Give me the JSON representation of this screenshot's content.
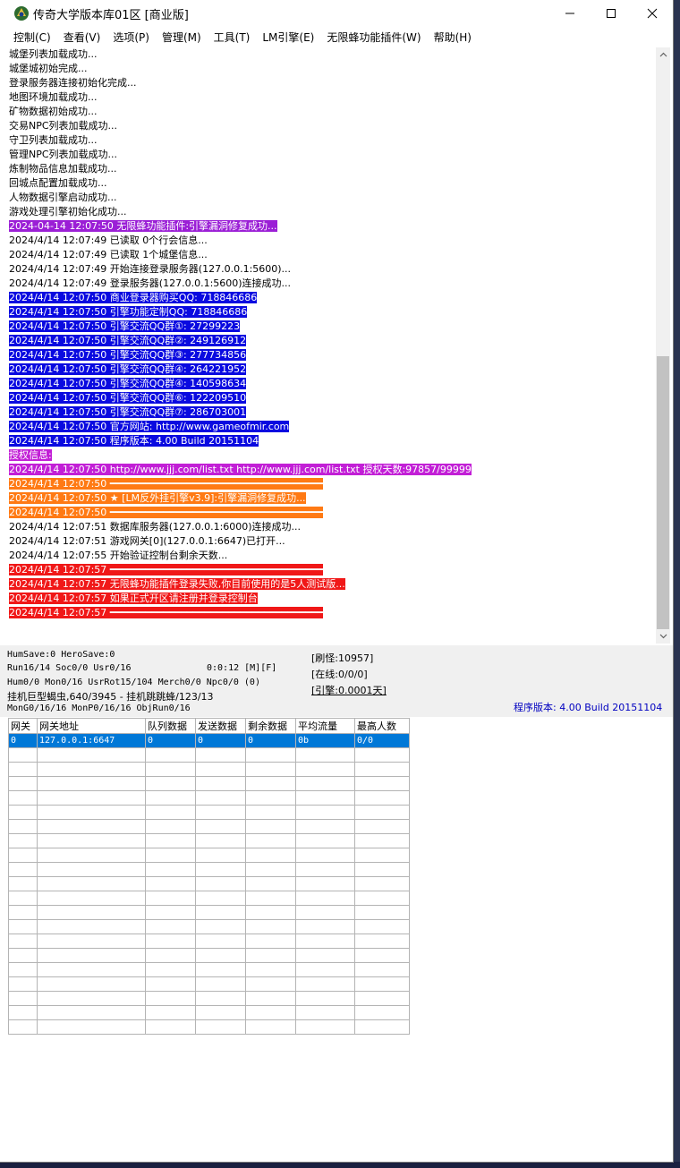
{
  "window": {
    "title": "传奇大学版本库01区 [商业版]",
    "minimize": "—",
    "maximize": "☐",
    "close": "✕"
  },
  "menu": [
    "控制(C)",
    "查看(V)",
    "选项(P)",
    "管理(M)",
    "工具(T)",
    "LM引擎(E)",
    "无限蜂功能插件(W)",
    "帮助(H)"
  ],
  "log": [
    {
      "text": "城堡列表加载成功...",
      "bg": "",
      "fg": "#000000"
    },
    {
      "text": "城堡城初始完成...",
      "bg": "",
      "fg": "#000000"
    },
    {
      "text": "登录服务器连接初始化完成...",
      "bg": "",
      "fg": "#000000"
    },
    {
      "text": "地图环境加载成功...",
      "bg": "",
      "fg": "#000000"
    },
    {
      "text": "矿物数据初始成功...",
      "bg": "",
      "fg": "#000000"
    },
    {
      "text": "交易NPC列表加载成功...",
      "bg": "",
      "fg": "#000000"
    },
    {
      "text": "守卫列表加载成功...",
      "bg": "",
      "fg": "#000000"
    },
    {
      "text": "管理NPC列表加载成功...",
      "bg": "",
      "fg": "#000000"
    },
    {
      "text": "炼制物品信息加载成功...",
      "bg": "",
      "fg": "#000000"
    },
    {
      "text": "回城点配置加载成功...",
      "bg": "",
      "fg": "#000000"
    },
    {
      "text": "人物数据引擎启动成功...",
      "bg": "",
      "fg": "#000000"
    },
    {
      "text": "游戏处理引擎初始化成功...",
      "bg": "",
      "fg": "#000000"
    },
    {
      "text": "2024-04-14 12:07:50 无限蜂功能插件:引擎漏洞修复成功...",
      "bg": "#9b1fd6",
      "fg": "#ffffff"
    },
    {
      "text": "2024/4/14 12:07:49 已读取 0个行会信息...",
      "bg": "",
      "fg": "#000000"
    },
    {
      "text": "2024/4/14 12:07:49 已读取 1个城堡信息...",
      "bg": "",
      "fg": "#000000"
    },
    {
      "text": "2024/4/14 12:07:49 开始连接登录服务器(127.0.0.1:5600)...",
      "bg": "",
      "fg": "#000000"
    },
    {
      "text": "2024/4/14 12:07:49 登录服务器(127.0.0.1:5600)连接成功...",
      "bg": "",
      "fg": "#000000"
    },
    {
      "text": "2024/4/14 12:07:50 商业登录器购买QQ: 718846686",
      "bg": "#0a0ae0",
      "fg": "#ffffff"
    },
    {
      "text": "2024/4/14 12:07:50 引擎功能定制QQ: 718846686",
      "bg": "#0a0ae0",
      "fg": "#ffffff"
    },
    {
      "text": "2024/4/14 12:07:50 引擎交流QQ群①: 27299223",
      "bg": "#0a0ae0",
      "fg": "#ffffff"
    },
    {
      "text": "2024/4/14 12:07:50 引擎交流QQ群②: 249126912",
      "bg": "#0a0ae0",
      "fg": "#ffffff"
    },
    {
      "text": "2024/4/14 12:07:50 引擎交流QQ群③: 277734856",
      "bg": "#0a0ae0",
      "fg": "#ffffff"
    },
    {
      "text": "2024/4/14 12:07:50 引擎交流QQ群④: 264221952",
      "bg": "#0a0ae0",
      "fg": "#ffffff"
    },
    {
      "text": "2024/4/14 12:07:50 引擎交流QQ群④: 140598634",
      "bg": "#0a0ae0",
      "fg": "#ffffff"
    },
    {
      "text": "2024/4/14 12:07:50 引擎交流QQ群⑥: 122209510",
      "bg": "#0a0ae0",
      "fg": "#ffffff"
    },
    {
      "text": "2024/4/14 12:07:50 引擎交流QQ群⑦: 286703001",
      "bg": "#0a0ae0",
      "fg": "#ffffff"
    },
    {
      "text": "2024/4/14 12:07:50 官方网站: http://www.gameofmir.com",
      "bg": "#0a0ae0",
      "fg": "#ffffff"
    },
    {
      "text": "2024/4/14 12:07:50 程序版本: 4.00 Build 20151104",
      "bg": "#0a0ae0",
      "fg": "#ffffff"
    },
    {
      "text": "授权信息:",
      "bg": "#c21fd6",
      "fg": "#ffffff"
    },
    {
      "text": "2024/4/14 12:07:50 http://www.jjj.com/list.txt http://www.jjj.com/list.txt 授权天数:97857/99999",
      "bg": "#c21fd6",
      "fg": "#ffffff"
    },
    {
      "text": "2024/4/14 12:07:50 ━━━━━━━━━━━━━━━━━━━━━━━━━━━━━━━━━━━━",
      "bg": "#ff7a14",
      "fg": "#ffffff"
    },
    {
      "text": "2024/4/14 12:07:50 ★ [LM反外挂引擎v3.9]:引擎漏洞修复成功...",
      "bg": "#ff7a14",
      "fg": "#ffffff"
    },
    {
      "text": "2024/4/14 12:07:50 ━━━━━━━━━━━━━━━━━━━━━━━━━━━━━━━━━━━━",
      "bg": "#ff7a14",
      "fg": "#ffffff"
    },
    {
      "text": "2024/4/14 12:07:51 数据库服务器(127.0.0.1:6000)连接成功...",
      "bg": "",
      "fg": "#000000"
    },
    {
      "text": "2024/4/14 12:07:51 游戏网关[0](127.0.0.1:6647)已打开...",
      "bg": "",
      "fg": "#000000"
    },
    {
      "text": "2024/4/14 12:07:55 开始验证控制台剩余天数...",
      "bg": "",
      "fg": "#000000"
    },
    {
      "text": "2024/4/14 12:07:57 ━━━━━━━━━━━━━━━━━━━━━━━━━━━━━━━━━━━━",
      "bg": "#f01818",
      "fg": "#ffffff"
    },
    {
      "text": "2024/4/14 12:07:57 无限蜂功能插件登录失败,你目前使用的是5人测试版...",
      "bg": "#f01818",
      "fg": "#ffffff"
    },
    {
      "text": "2024/4/14 12:07:57 如果正式开区请注册并登录控制台",
      "bg": "#f01818",
      "fg": "#ffffff"
    },
    {
      "text": "2024/4/14 12:07:57 ━━━━━━━━━━━━━━━━━━━━━━━━━━━━━━━━━━━━",
      "bg": "#f01818",
      "fg": "#ffffff"
    }
  ],
  "status": {
    "line1": "HumSave:0 HeroSave:0",
    "line2": "Run16/14 Soc0/0 Usr0/16",
    "time": "0:0:12 [M][F]",
    "line3": "Hum0/0 Mon0/16 UsrRot15/104 Merch0/0 Npc0/0 (0)",
    "line4": "挂机巨型蝎虫,640/3945 - 挂机跳跳蜂/123/13",
    "line5": "MonG0/16/16 MonP0/16/16 ObjRun0/16",
    "refresh": "[刷怪:10957]",
    "online": "[在线:0/0/0]",
    "engine": "[引擎:0.0001天]",
    "version": "程序版本: 4.00 Build 20151104"
  },
  "gateway": {
    "headers": [
      "网关",
      "网关地址",
      "队列数据",
      "发送数据",
      "剩余数据",
      "平均流量",
      "最高人数"
    ],
    "rows": [
      [
        "0",
        "127.0.0.1:6647",
        "0",
        "0",
        "0",
        "0b",
        "0/0"
      ]
    ],
    "empty_rows": 20
  },
  "colors": {
    "selection": "#0078d7",
    "version_text": "#0000c0"
  }
}
